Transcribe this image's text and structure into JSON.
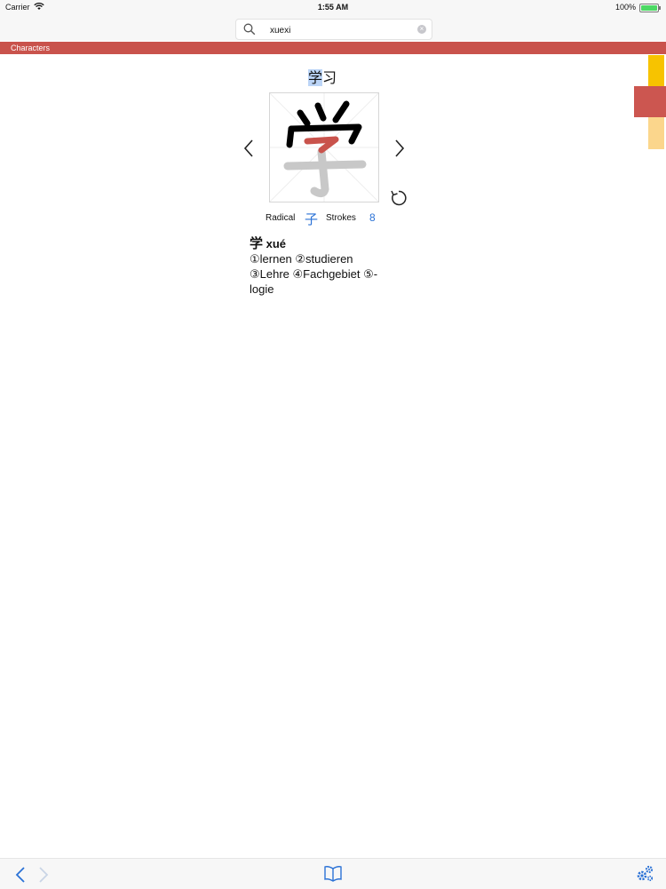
{
  "status": {
    "carrier": "Carrier",
    "time": "1:55 AM",
    "battery": "100%"
  },
  "search": {
    "value": "xuexi"
  },
  "section": {
    "title": "Characters"
  },
  "word": {
    "selected": "学",
    "rest": "习"
  },
  "character": {
    "glyph": "学",
    "radical_label": "Radical",
    "radical": "子",
    "strokes_label": "Strokes",
    "strokes": "8"
  },
  "definition": {
    "char": "学",
    "pinyin": "xué",
    "line1": "①lernen ②studieren",
    "line2": "③Lehre ④Fachgebiet ⑤-",
    "line3": "logie"
  },
  "colors": {
    "header": "#c9534c",
    "accent": "#2b72d6",
    "stroke_highlight": "#c9534c",
    "side_tabs": [
      "#f7c300",
      "#cc5650",
      "#fbd68c"
    ]
  },
  "icons": [
    "wifi-icon",
    "battery-icon",
    "search-icon",
    "clear-icon",
    "chevron-left-icon",
    "chevron-right-icon",
    "replay-icon",
    "back-icon",
    "forward-icon",
    "book-icon",
    "settings-icon"
  ]
}
